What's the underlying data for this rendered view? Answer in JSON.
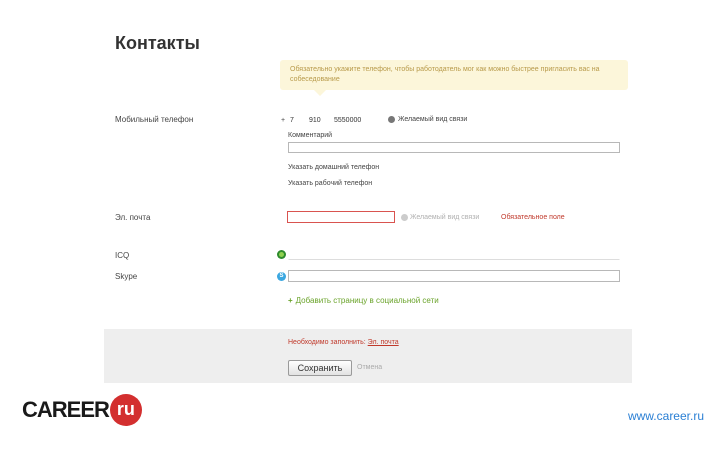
{
  "page": {
    "title": "Контакты"
  },
  "tooltip": {
    "text": "Обязательно укажите телефон, чтобы работодатель мог как можно быстрее пригласить вас на собеседование"
  },
  "phone": {
    "label": "Мобильный телефон",
    "country_code": "7",
    "area_code": "910",
    "number": "5550000",
    "preferred_label": "Желаемый вид связи",
    "comment_link": "Комментарий",
    "add_home": "Указать домашний телефон",
    "add_work": "Указать рабочий телефон"
  },
  "email": {
    "label": "Эл. почта",
    "value": "",
    "preferred_label": "Желаемый вид связи",
    "required_note": "Обязательное поле"
  },
  "icq": {
    "label": "ICQ",
    "value": ""
  },
  "skype": {
    "label": "Skype",
    "value": ""
  },
  "add_social": {
    "label": "Добавить страницу в социальной сети"
  },
  "footer": {
    "required_prefix": "Необходимо заполнить:",
    "required_field": "Эл. почта",
    "save_label": "Сохранить",
    "cancel_label": "Отмена"
  },
  "branding": {
    "logo_text": "CAREER",
    "logo_ru": "ru",
    "site_url": "www.career.ru"
  }
}
